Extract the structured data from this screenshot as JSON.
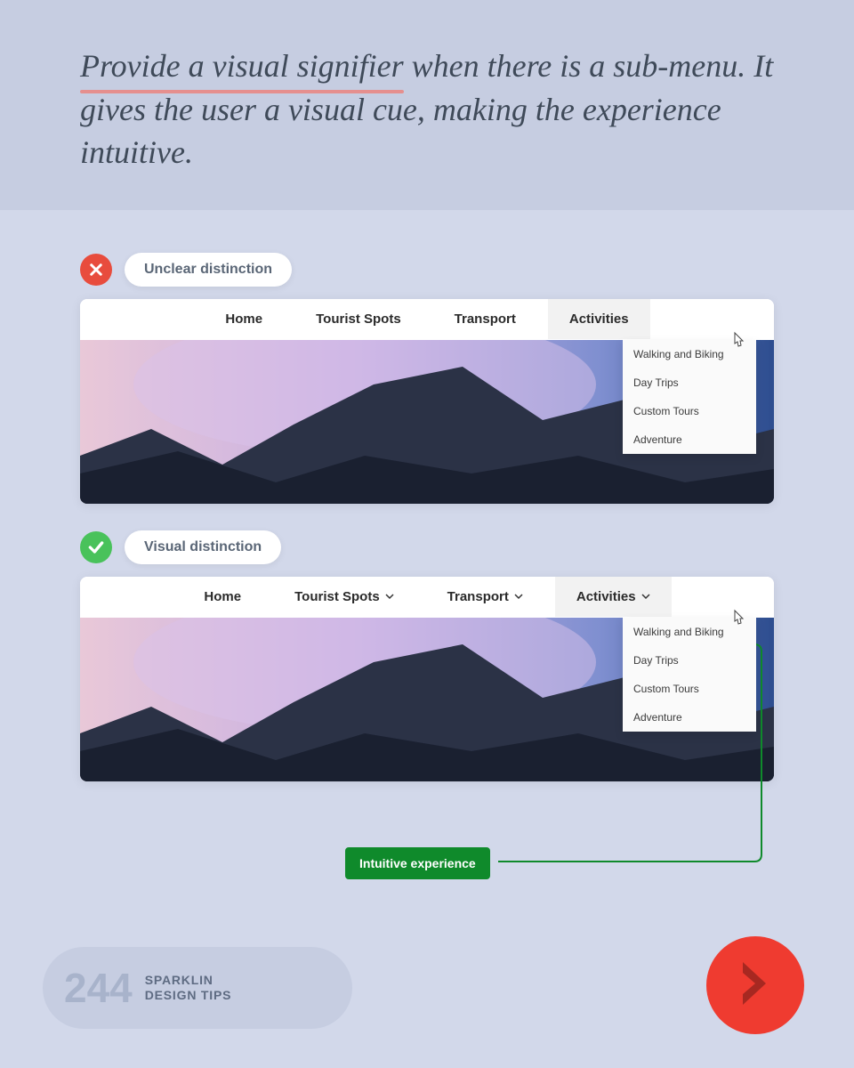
{
  "headline": {
    "emphasis": "Provide a visual signifier",
    "rest": " when there is a sub-menu. It gives the user a visual cue, making the experience intuitive."
  },
  "examples": {
    "bad": {
      "label": "Unclear distinction",
      "nav": [
        "Home",
        "Tourist Spots",
        "Transport",
        "Activities"
      ],
      "dropdown": [
        "Walking and Biking",
        "Day Trips",
        "Custom Tours",
        "Adventure"
      ]
    },
    "good": {
      "label": "Visual distinction",
      "nav": [
        "Home",
        "Tourist Spots",
        "Transport",
        "Activities"
      ],
      "chevron_on": [
        false,
        true,
        true,
        true
      ],
      "dropdown": [
        "Walking and Biking",
        "Day Trips",
        "Custom Tours",
        "Adventure"
      ]
    }
  },
  "callout": "Intuitive experience",
  "footer": {
    "number": "244",
    "line1": "SPARKLIN",
    "line2": "DESIGN TIPS"
  }
}
